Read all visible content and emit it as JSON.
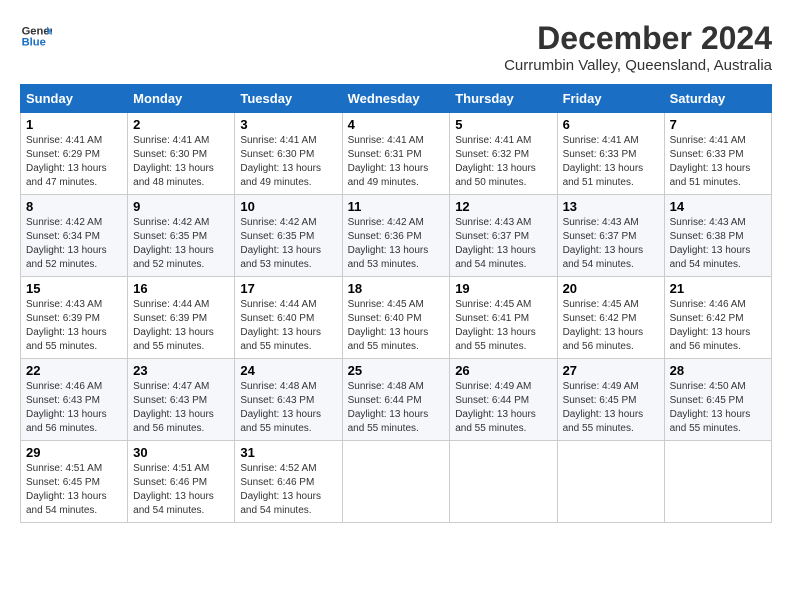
{
  "logo": {
    "line1": "General",
    "line2": "Blue"
  },
  "title": "December 2024",
  "location": "Currumbin Valley, Queensland, Australia",
  "weekdays": [
    "Sunday",
    "Monday",
    "Tuesday",
    "Wednesday",
    "Thursday",
    "Friday",
    "Saturday"
  ],
  "weeks": [
    [
      {
        "day": "1",
        "sunrise": "4:41 AM",
        "sunset": "6:29 PM",
        "daylight": "13 hours and 47 minutes."
      },
      {
        "day": "2",
        "sunrise": "4:41 AM",
        "sunset": "6:30 PM",
        "daylight": "13 hours and 48 minutes."
      },
      {
        "day": "3",
        "sunrise": "4:41 AM",
        "sunset": "6:30 PM",
        "daylight": "13 hours and 49 minutes."
      },
      {
        "day": "4",
        "sunrise": "4:41 AM",
        "sunset": "6:31 PM",
        "daylight": "13 hours and 49 minutes."
      },
      {
        "day": "5",
        "sunrise": "4:41 AM",
        "sunset": "6:32 PM",
        "daylight": "13 hours and 50 minutes."
      },
      {
        "day": "6",
        "sunrise": "4:41 AM",
        "sunset": "6:33 PM",
        "daylight": "13 hours and 51 minutes."
      },
      {
        "day": "7",
        "sunrise": "4:41 AM",
        "sunset": "6:33 PM",
        "daylight": "13 hours and 51 minutes."
      }
    ],
    [
      {
        "day": "8",
        "sunrise": "4:42 AM",
        "sunset": "6:34 PM",
        "daylight": "13 hours and 52 minutes."
      },
      {
        "day": "9",
        "sunrise": "4:42 AM",
        "sunset": "6:35 PM",
        "daylight": "13 hours and 52 minutes."
      },
      {
        "day": "10",
        "sunrise": "4:42 AM",
        "sunset": "6:35 PM",
        "daylight": "13 hours and 53 minutes."
      },
      {
        "day": "11",
        "sunrise": "4:42 AM",
        "sunset": "6:36 PM",
        "daylight": "13 hours and 53 minutes."
      },
      {
        "day": "12",
        "sunrise": "4:43 AM",
        "sunset": "6:37 PM",
        "daylight": "13 hours and 54 minutes."
      },
      {
        "day": "13",
        "sunrise": "4:43 AM",
        "sunset": "6:37 PM",
        "daylight": "13 hours and 54 minutes."
      },
      {
        "day": "14",
        "sunrise": "4:43 AM",
        "sunset": "6:38 PM",
        "daylight": "13 hours and 54 minutes."
      }
    ],
    [
      {
        "day": "15",
        "sunrise": "4:43 AM",
        "sunset": "6:39 PM",
        "daylight": "13 hours and 55 minutes."
      },
      {
        "day": "16",
        "sunrise": "4:44 AM",
        "sunset": "6:39 PM",
        "daylight": "13 hours and 55 minutes."
      },
      {
        "day": "17",
        "sunrise": "4:44 AM",
        "sunset": "6:40 PM",
        "daylight": "13 hours and 55 minutes."
      },
      {
        "day": "18",
        "sunrise": "4:45 AM",
        "sunset": "6:40 PM",
        "daylight": "13 hours and 55 minutes."
      },
      {
        "day": "19",
        "sunrise": "4:45 AM",
        "sunset": "6:41 PM",
        "daylight": "13 hours and 55 minutes."
      },
      {
        "day": "20",
        "sunrise": "4:45 AM",
        "sunset": "6:42 PM",
        "daylight": "13 hours and 56 minutes."
      },
      {
        "day": "21",
        "sunrise": "4:46 AM",
        "sunset": "6:42 PM",
        "daylight": "13 hours and 56 minutes."
      }
    ],
    [
      {
        "day": "22",
        "sunrise": "4:46 AM",
        "sunset": "6:43 PM",
        "daylight": "13 hours and 56 minutes."
      },
      {
        "day": "23",
        "sunrise": "4:47 AM",
        "sunset": "6:43 PM",
        "daylight": "13 hours and 56 minutes."
      },
      {
        "day": "24",
        "sunrise": "4:48 AM",
        "sunset": "6:43 PM",
        "daylight": "13 hours and 55 minutes."
      },
      {
        "day": "25",
        "sunrise": "4:48 AM",
        "sunset": "6:44 PM",
        "daylight": "13 hours and 55 minutes."
      },
      {
        "day": "26",
        "sunrise": "4:49 AM",
        "sunset": "6:44 PM",
        "daylight": "13 hours and 55 minutes."
      },
      {
        "day": "27",
        "sunrise": "4:49 AM",
        "sunset": "6:45 PM",
        "daylight": "13 hours and 55 minutes."
      },
      {
        "day": "28",
        "sunrise": "4:50 AM",
        "sunset": "6:45 PM",
        "daylight": "13 hours and 55 minutes."
      }
    ],
    [
      {
        "day": "29",
        "sunrise": "4:51 AM",
        "sunset": "6:45 PM",
        "daylight": "13 hours and 54 minutes."
      },
      {
        "day": "30",
        "sunrise": "4:51 AM",
        "sunset": "6:46 PM",
        "daylight": "13 hours and 54 minutes."
      },
      {
        "day": "31",
        "sunrise": "4:52 AM",
        "sunset": "6:46 PM",
        "daylight": "13 hours and 54 minutes."
      },
      null,
      null,
      null,
      null
    ]
  ]
}
